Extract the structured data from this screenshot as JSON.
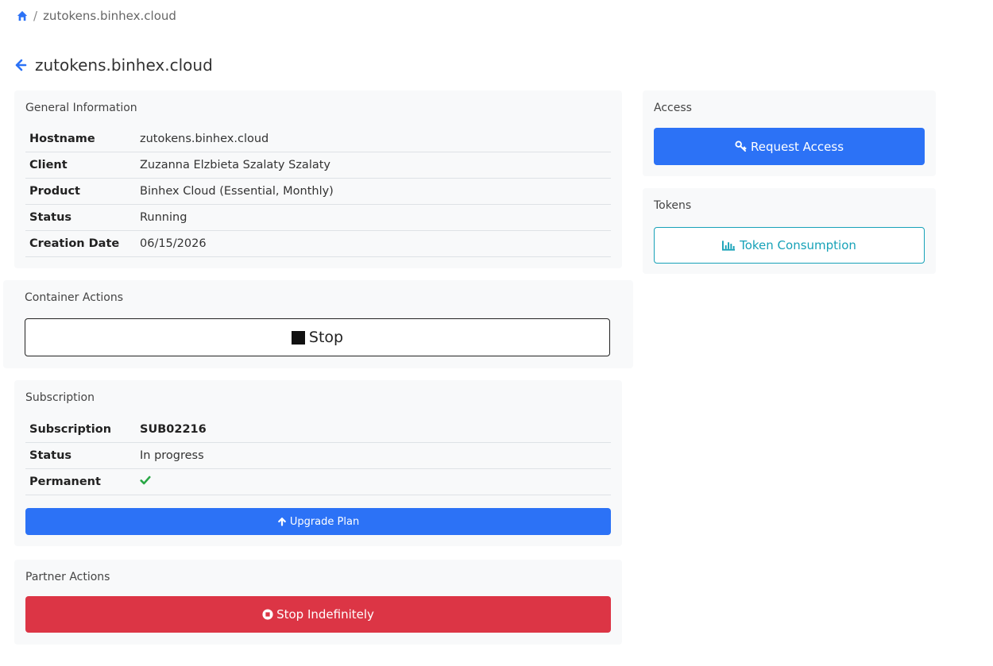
{
  "breadcrumb": {
    "separator": "/",
    "current": "zutokens.binhex.cloud"
  },
  "page": {
    "title": "zutokens.binhex.cloud"
  },
  "general": {
    "title": "General Information",
    "rows": [
      {
        "key": "Hostname",
        "value": "zutokens.binhex.cloud"
      },
      {
        "key": "Client",
        "value": "Zuzanna Elzbieta Szalaty Szalaty"
      },
      {
        "key": "Product",
        "value": "Binhex Cloud (Essential, Monthly)"
      },
      {
        "key": "Status",
        "value": "Running"
      },
      {
        "key": "Creation Date",
        "value": "06/15/2026"
      }
    ]
  },
  "container_actions": {
    "title": "Container Actions",
    "stop_label": "Stop"
  },
  "subscription": {
    "title": "Subscription",
    "rows": [
      {
        "key": "Subscription",
        "value": "SUB02216"
      },
      {
        "key": "Status",
        "value": "In progress"
      },
      {
        "key": "Permanent",
        "value": ""
      }
    ],
    "upgrade_label": "Upgrade Plan"
  },
  "partner_actions": {
    "title": "Partner Actions",
    "stop_indefinitely_label": "Stop Indefinitely"
  },
  "access": {
    "title": "Access",
    "request_label": "Request Access"
  },
  "tokens": {
    "title": "Tokens",
    "consumption_label": "Token Consumption"
  },
  "icons": {
    "home": "home-icon",
    "back": "arrow-left-icon",
    "stop": "stop-square-icon",
    "check": "check-icon",
    "upgrade": "arrow-up-icon",
    "partner_stop": "stop-circle-icon",
    "key": "key-icon",
    "chart": "bar-chart-icon"
  },
  "colors": {
    "primary": "#2c72f6",
    "danger": "#dc3545",
    "info": "#17a2b8",
    "success": "#28a745",
    "card_bg": "#f8f9fa"
  }
}
